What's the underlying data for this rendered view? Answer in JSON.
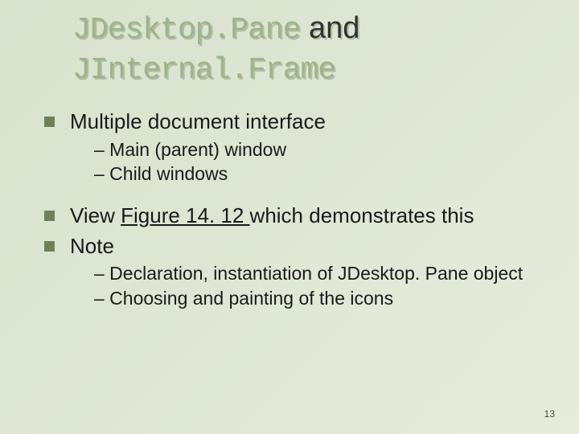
{
  "title": {
    "code1": "JDesktop.Pane",
    "plain1": " and ",
    "code2": "JInternal.Frame"
  },
  "bullets": {
    "b1": "Multiple document interface",
    "b1_sub1": "– Main (parent) window",
    "b1_sub2": "– Child windows",
    "b2_pre": "View ",
    "b2_link": "Figure 14. 12 ",
    "b2_post": "which demonstrates this",
    "b3": "Note",
    "b3_sub1": "– Declaration, instantiation of JDesktop. Pane object",
    "b3_sub2": "– Choosing and painting of the icons"
  },
  "page_number": "13"
}
